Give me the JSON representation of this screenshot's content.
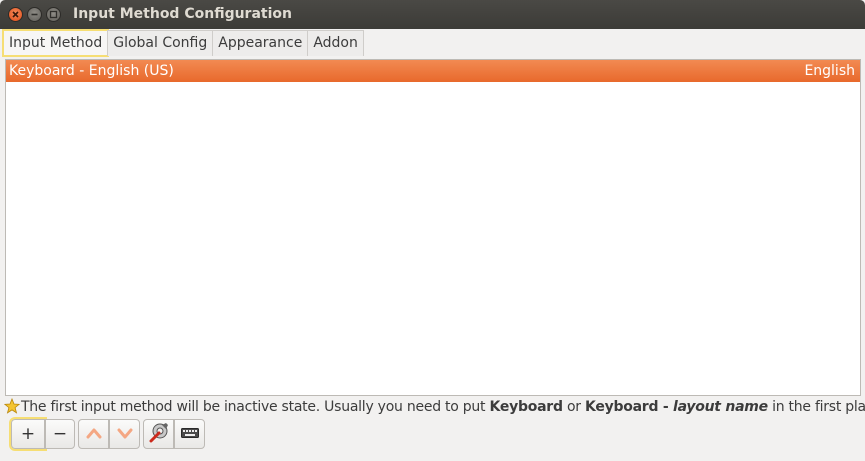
{
  "window": {
    "title": "Input Method Configuration",
    "controls": [
      "close-icon",
      "minimize-icon",
      "maximize-icon"
    ]
  },
  "tabs": [
    {
      "label": "Input Method",
      "active": true
    },
    {
      "label": "Global Config",
      "active": false
    },
    {
      "label": "Appearance",
      "active": false
    },
    {
      "label": "Addon",
      "active": false
    }
  ],
  "list": {
    "rows": [
      {
        "name": "Keyboard - English (US)",
        "language": "English",
        "selected": true
      }
    ]
  },
  "hint": {
    "icon": "star-icon",
    "text_1": "The first input method will be inactive state. Usually you need to put ",
    "bold_1": "Keyboard",
    "text_2": " or ",
    "bold_2": "Keyboard - ",
    "bold_italic": "layout name",
    "text_3": " in the first place."
  },
  "toolbar": {
    "add_label": "+",
    "remove_label": "−",
    "icons": [
      "arrow-up-icon",
      "arrow-down-icon",
      "configure-icon",
      "keyboard-layout-icon"
    ]
  },
  "colors": {
    "selection": "#e8692c",
    "highlight_outline": "#f6de74",
    "titlebar": "#3c3b37"
  }
}
